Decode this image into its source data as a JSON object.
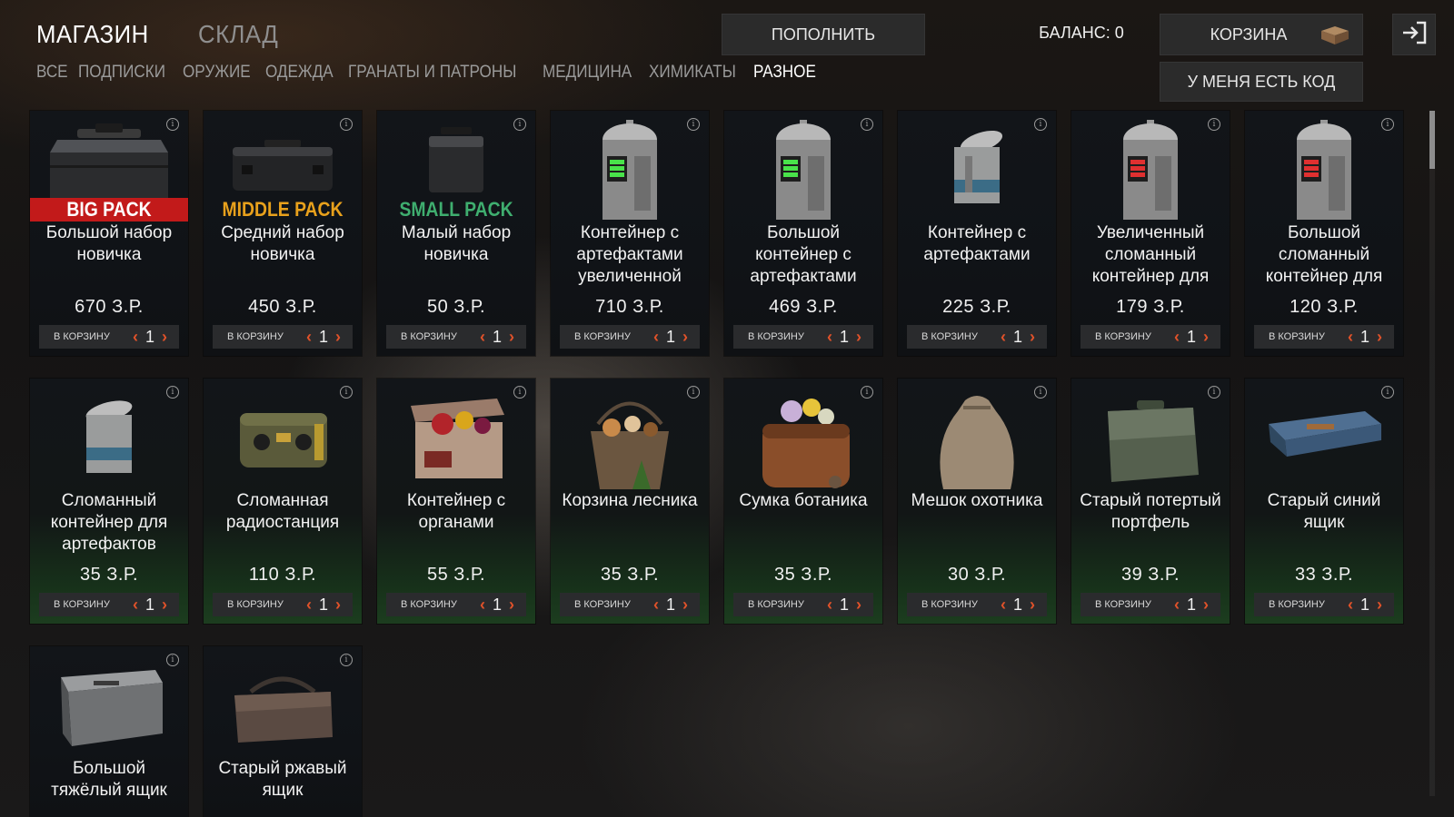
{
  "tabs": {
    "shop": "МАГАЗИН",
    "warehouse": "СКЛАД"
  },
  "categories": [
    "ВСЕ",
    "ПОДПИСКИ",
    "ОРУЖИЕ",
    "ОДЕЖДА",
    "ГРАНАТЫ И ПАТРОНЫ",
    "МЕДИЦИНА",
    "ХИМИКАТЫ",
    "РАЗНОЕ"
  ],
  "active_category": "РАЗНОЕ",
  "topup_label": "ПОПОЛНИТЬ",
  "balance_text": "БАЛАНС: 0",
  "cart_label": "КОРЗИНА",
  "code_label": "У МЕНЯ ЕСТЬ КОД",
  "buy_label": "В КОРЗИНУ",
  "items": [
    {
      "pack": "BIG PACK",
      "name": "Большой набор новичка",
      "price": "670 З.Р.",
      "qty": "1"
    },
    {
      "pack": "MIDDLE PACK",
      "name": "Средний набор новичка",
      "price": "450 З.Р.",
      "qty": "1"
    },
    {
      "pack": "SMALL PACK",
      "name": "Малый набор новичка",
      "price": "50 З.Р.",
      "qty": "1"
    },
    {
      "name": "Контейнер с артефактами увеличенной",
      "price": "710 З.Р.",
      "qty": "1"
    },
    {
      "name": "Большой контейнер с артефактами",
      "price": "469 З.Р.",
      "qty": "1"
    },
    {
      "name": "Контейнер с артефактами",
      "price": "225 З.Р.",
      "qty": "1"
    },
    {
      "name": "Увеличенный сломанный контейнер для",
      "price": "179 З.Р.",
      "qty": "1"
    },
    {
      "name": "Большой сломанный контейнер для",
      "price": "120 З.Р.",
      "qty": "1"
    },
    {
      "name": "Сломанный контейнер для артефактов",
      "price": "35 З.Р.",
      "qty": "1"
    },
    {
      "name": "Сломанная радиостанция",
      "price": "110 З.Р.",
      "qty": "1"
    },
    {
      "name": "Контейнер с органами",
      "price": "55 З.Р.",
      "qty": "1"
    },
    {
      "name": "Корзина лесника",
      "price": "35 З.Р.",
      "qty": "1"
    },
    {
      "name": "Сумка ботаника",
      "price": "35 З.Р.",
      "qty": "1"
    },
    {
      "name": "Мешок охотника",
      "price": "30 З.Р.",
      "qty": "1"
    },
    {
      "name": "Старый потертый портфель",
      "price": "39 З.Р.",
      "qty": "1"
    },
    {
      "name": "Старый синий ящик",
      "price": "33 З.Р.",
      "qty": "1"
    },
    {
      "name": "Большой тяжёлый ящик",
      "price": "",
      "qty": ""
    },
    {
      "name": "Старый ржавый ящик",
      "price": "",
      "qty": ""
    }
  ]
}
